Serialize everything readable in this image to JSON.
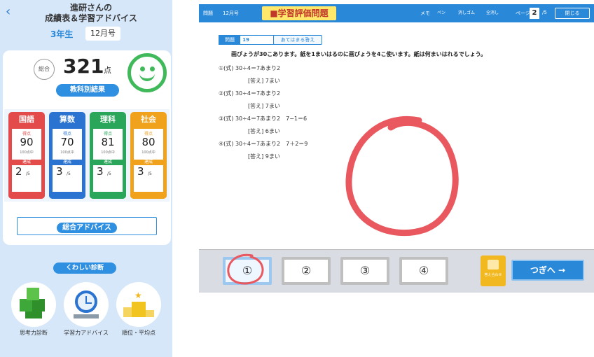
{
  "header": {
    "back_icon": "chevron-left-icon",
    "title_line1": "進研さんの",
    "title_line2": "成績表＆学習アドバイス",
    "grade": "3年生",
    "month": "12月号"
  },
  "summary": {
    "total_label": "総合",
    "total_score": "321",
    "total_unit": "点",
    "mood_icon": "smiley-face-icon",
    "subject_results_label": "教科別結果"
  },
  "subjects": [
    {
      "name": "国語",
      "color": "#e34b4b",
      "score_label": "得点",
      "score": "90",
      "sub_label": "100点中",
      "level_label": "達成",
      "level": "2",
      "level_unit": "/5"
    },
    {
      "name": "算数",
      "color": "#2a73d0",
      "score_label": "得点",
      "score": "70",
      "sub_label": "100点中",
      "level_label": "達成",
      "level": "3",
      "level_unit": "/5"
    },
    {
      "name": "理科",
      "color": "#2aa65a",
      "score_label": "得点",
      "score": "81",
      "sub_label": "100点中",
      "level_label": "達成",
      "level": "3",
      "level_unit": "/5"
    },
    {
      "name": "社会",
      "color": "#f0a21d",
      "score_label": "得点",
      "score": "80",
      "sub_label": "100点中",
      "level_label": "達成",
      "level": "3",
      "level_unit": "/5"
    }
  ],
  "overall_advice_label": "総合アドバイス",
  "detailed_diagnosis_label": "くわしい診断",
  "diagnosis_items": [
    {
      "label": "思考力診断",
      "icon": "green-cubes-icon"
    },
    {
      "label": "学習力アドバイス",
      "icon": "alarm-clock-icon"
    },
    {
      "label": "順位・平均点",
      "icon": "ranking-podium-icon"
    }
  ],
  "toolbar": {
    "left1": "問題",
    "left2": "12月号",
    "title": "■学習評価問題",
    "memo": "メモ",
    "tools": [
      "ペン",
      "消しゴム",
      "全消し"
    ],
    "zoom_label": "ページ",
    "zoom_value": "2",
    "zoom_unit": "/5",
    "close": "閉じる"
  },
  "problem": {
    "kind": "問題",
    "number": "19",
    "tag": "あてはまる答え",
    "text": "画びょうが30こあります。紙を1まいはるのに画びょうを4こ使います。紙は何まいはれるでしょう。",
    "options": [
      {
        "marker": "①(式)",
        "expr": "30÷4＝7あまり2",
        "answer": "[答え] 7まい"
      },
      {
        "marker": "②(式)",
        "expr": "30÷4＝7あまり2",
        "answer": "[答え] 7まい"
      },
      {
        "marker": "③(式)",
        "expr": "30÷4＝7あまり2　7−1＝6",
        "answer": "[答え] 6まい"
      },
      {
        "marker": "④(式)",
        "expr": "30÷4＝7あまり2　7＋2＝9",
        "answer": "[答え] 9まい"
      }
    ]
  },
  "choices": [
    "①",
    "②",
    "③",
    "④"
  ],
  "lock_label": "答え合わせ",
  "next_label": "つぎへ →",
  "colors": {
    "accent": "#2a88d8",
    "red_mark": "#e8585e"
  }
}
